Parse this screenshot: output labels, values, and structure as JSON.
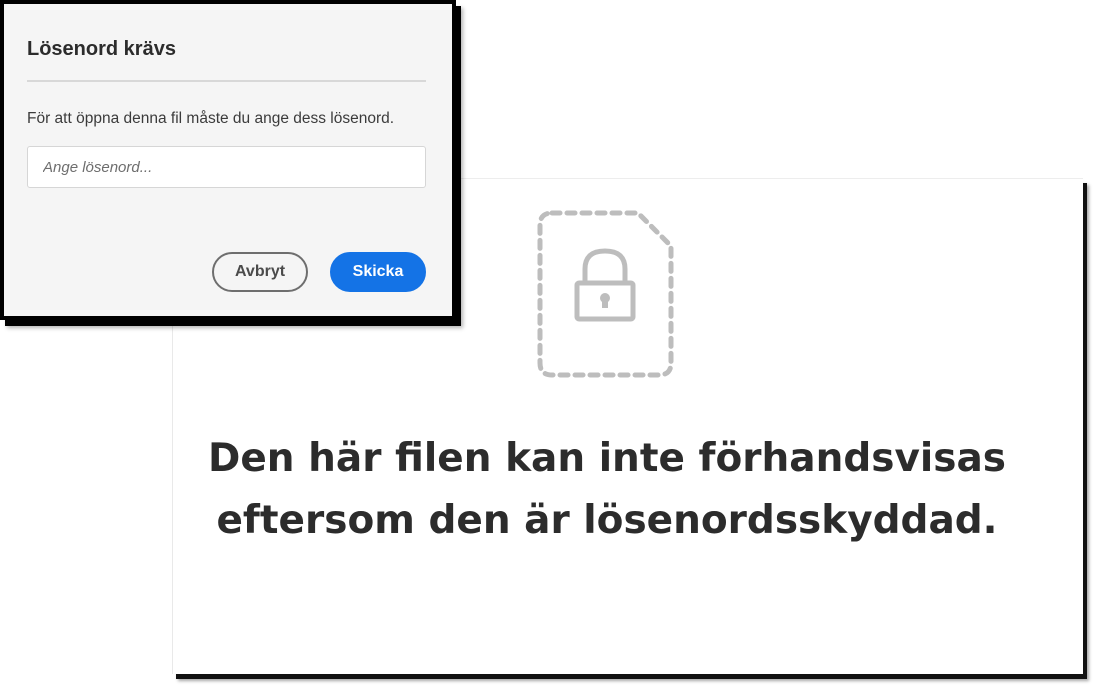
{
  "dialog": {
    "title": "Lösenord krävs",
    "message": "För att öppna denna fil måste du ange dess lösenord.",
    "password_field": {
      "placeholder": "Ange lösenord...",
      "value": ""
    },
    "cancel_label": "Avbryt",
    "submit_label": "Skicka"
  },
  "preview": {
    "icon": "locked-file-icon",
    "message_line1": "Den här filen kan inte förhandsvisas",
    "message_line2": "eftersom den är lösenordsskyddad."
  },
  "colors": {
    "accent": "#1473e6",
    "dialog_background": "#f5f5f5",
    "icon_gray": "#bdbdbd",
    "text_dark": "#2c2c2c"
  }
}
